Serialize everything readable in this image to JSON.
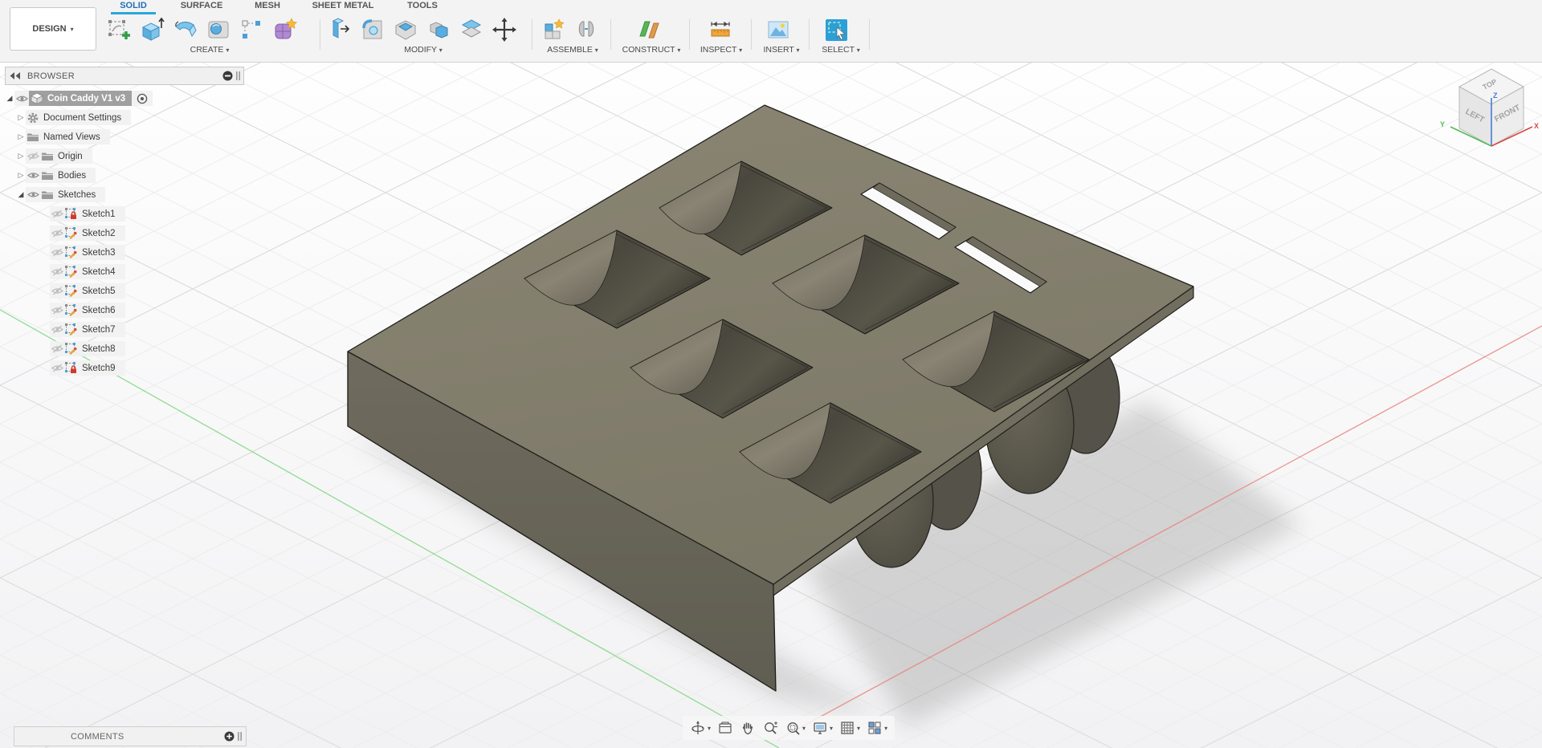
{
  "toolbar": {
    "design_label": "DESIGN",
    "tabs": [
      {
        "label": "SOLID",
        "active": true
      },
      {
        "label": "SURFACE",
        "active": false
      },
      {
        "label": "MESH",
        "active": false
      },
      {
        "label": "SHEET METAL",
        "active": false
      },
      {
        "label": "TOOLS",
        "active": false
      }
    ],
    "groups": [
      {
        "label": "CREATE"
      },
      {
        "label": "MODIFY"
      },
      {
        "label": "ASSEMBLE"
      },
      {
        "label": "CONSTRUCT"
      },
      {
        "label": "INSPECT"
      },
      {
        "label": "INSERT"
      },
      {
        "label": "SELECT"
      }
    ]
  },
  "browser": {
    "title": "BROWSER",
    "document": {
      "label": "Coin Caddy V1 v3",
      "selected": true
    },
    "folders": [
      {
        "label": "Document Settings"
      },
      {
        "label": "Named Views"
      },
      {
        "label": "Origin",
        "hidden": true
      },
      {
        "label": "Bodies"
      },
      {
        "label": "Sketches",
        "expanded": true
      }
    ],
    "sketches": [
      {
        "label": "Sketch1",
        "state": "locked"
      },
      {
        "label": "Sketch2",
        "state": "editable"
      },
      {
        "label": "Sketch3",
        "state": "editable"
      },
      {
        "label": "Sketch4",
        "state": "editable"
      },
      {
        "label": "Sketch5",
        "state": "editable"
      },
      {
        "label": "Sketch6",
        "state": "editable"
      },
      {
        "label": "Sketch7",
        "state": "editable"
      },
      {
        "label": "Sketch8",
        "state": "editable"
      },
      {
        "label": "Sketch9",
        "state": "locked"
      }
    ]
  },
  "comments": {
    "title": "COMMENTS"
  },
  "viewcube": {
    "faces": {
      "top": "TOP",
      "left": "LEFT",
      "front": "FRONT"
    },
    "axes": {
      "x": "X",
      "y": "Y",
      "z": "Z"
    }
  },
  "navbar": {
    "icons": [
      "orbit",
      "look-at",
      "pan",
      "zoom",
      "fit",
      "display-settings",
      "grid-and-snaps",
      "viewports"
    ]
  },
  "colors": {
    "active_tab_text": "#1f6fb5",
    "active_tab_underline": "#2aa7dc",
    "model_top": "#85816f",
    "model_side": "#6b675a",
    "pocket_dark": "#45433a",
    "axis_x": "#e8837c",
    "axis_y": "#86d986",
    "axis_z": "#4a79d6",
    "selection_gray": "#a0a0a0"
  }
}
